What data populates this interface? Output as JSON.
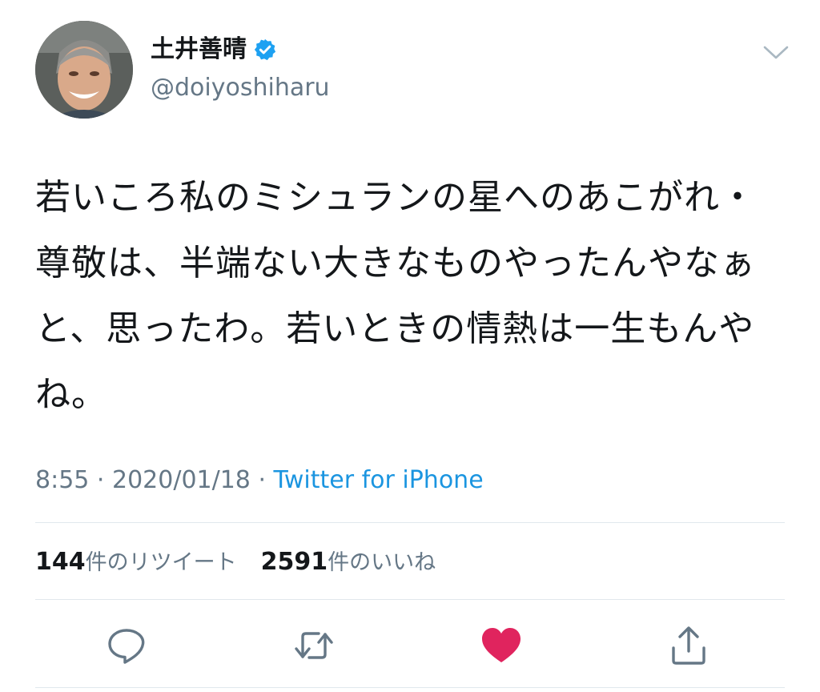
{
  "author": {
    "display_name": "土井善晴",
    "handle": "@doiyoshiharu",
    "verified": true
  },
  "tweet": {
    "text": "若いころ私のミシュランの星へのあこがれ・尊敬は、半端ない大きなものやったんやなぁと、思ったわ。若いときの情熱は一生もんやね。"
  },
  "meta": {
    "time": "8:55",
    "separator": " · ",
    "date": "2020/01/18",
    "separator2": " · ",
    "source": "Twitter for iPhone"
  },
  "stats": {
    "retweets_count": "144",
    "retweets_label": "件のリツイート",
    "likes_count": "2591",
    "likes_label": "件のいいね"
  },
  "actions": {
    "reply_icon": "reply-icon",
    "retweet_icon": "retweet-icon",
    "like_icon": "heart-icon",
    "share_icon": "share-icon"
  },
  "colors": {
    "text": "#14171a",
    "secondary": "#657786",
    "link": "#1b95e0",
    "verified": "#1da1f2",
    "like": "#e0245e",
    "divider": "#e1e8ed"
  }
}
